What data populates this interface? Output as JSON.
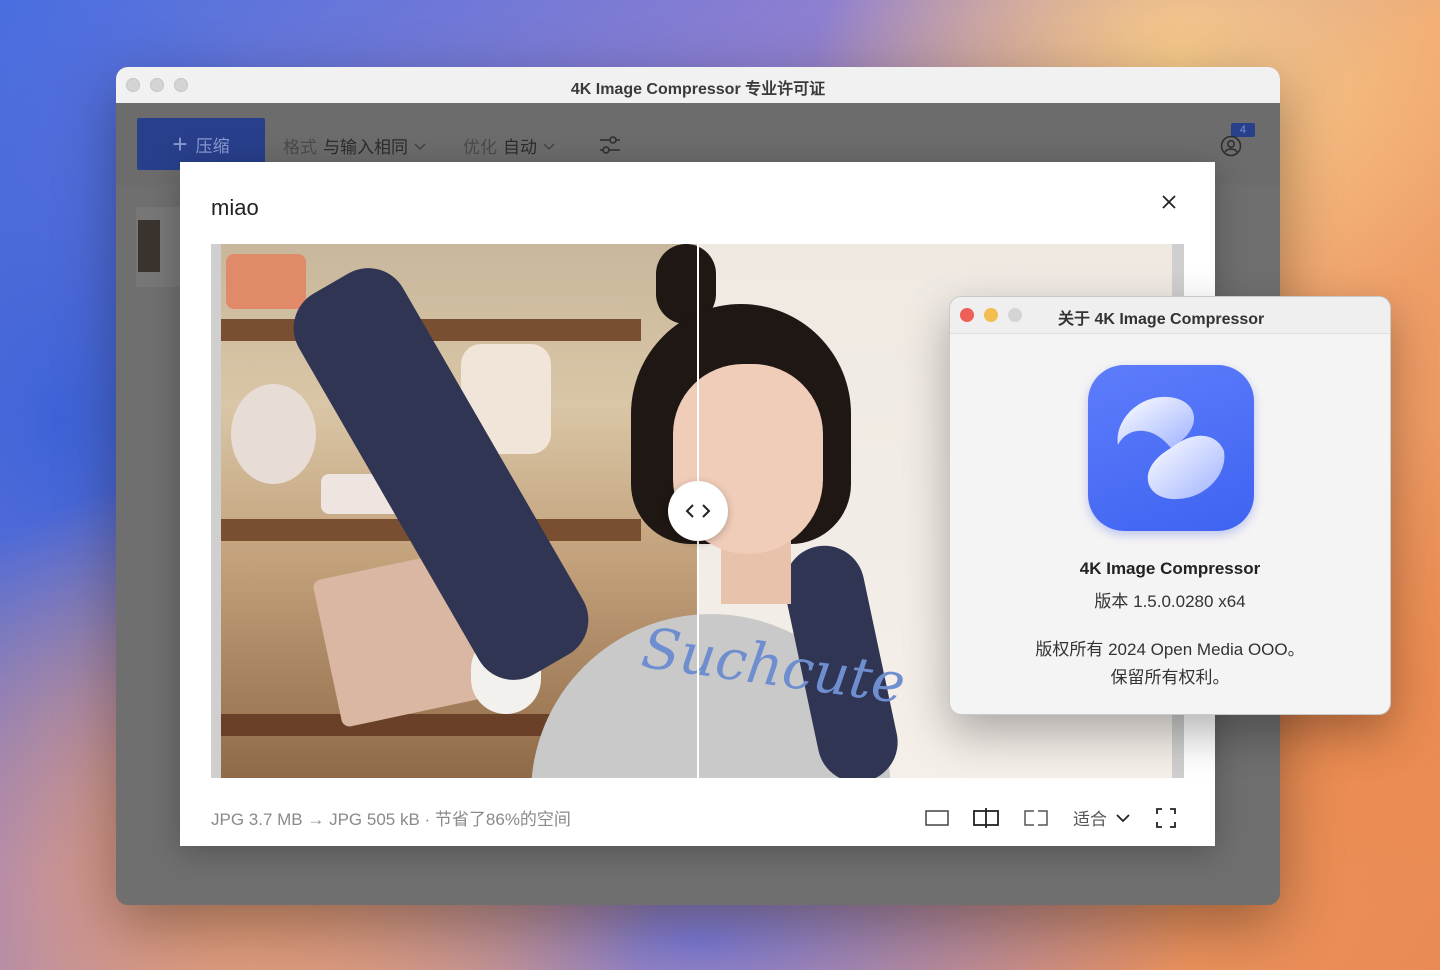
{
  "main_window": {
    "title": "4K Image Compressor 专业许可证",
    "toolbar": {
      "compress_label": "压缩",
      "format_label": "格式",
      "format_value": "与输入相同",
      "optimize_label": "优化",
      "optimize_value": "自动",
      "badge_count": "4"
    }
  },
  "preview": {
    "title": "miao",
    "image_text": "Suchcute",
    "footer_info": "JPG 3.7 MB → JPG 505 kB · 节省了86%的空间",
    "zoom_label": "适合"
  },
  "about": {
    "title": "关于 4K Image Compressor",
    "app_name": "4K Image Compressor",
    "version": "版本 1.5.0.0280 x64",
    "copyright": "版权所有 2024 Open Media OOO。",
    "rights": "保留所有权利。"
  },
  "colors": {
    "accent": "#283f8c",
    "logo_blue": "#4a6cf7",
    "close_red": "#ed5f57",
    "minimize_yellow": "#f4be4f",
    "inactive_gray": "#d4d4d4"
  }
}
